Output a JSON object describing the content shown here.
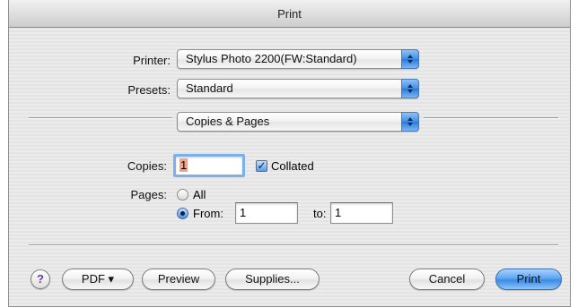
{
  "window": {
    "title": "Print"
  },
  "printer": {
    "label": "Printer:",
    "value": "Stylus Photo 2200(FW:Standard)"
  },
  "presets": {
    "label": "Presets:",
    "value": "Standard"
  },
  "panel": {
    "value": "Copies & Pages"
  },
  "copies": {
    "label": "Copies:",
    "value": "1",
    "collated_label": "Collated",
    "collated_checked": true,
    "check_glyph": "✓"
  },
  "pages": {
    "label": "Pages:",
    "all_label": "All",
    "from_label": "From:",
    "from_value": "1",
    "to_label": "to:",
    "to_value": "1",
    "selected": "From"
  },
  "buttons": {
    "help": "?",
    "pdf": "PDF ▾",
    "preview": "Preview",
    "supplies": "Supplies...",
    "cancel": "Cancel",
    "print": "Print"
  },
  "colors": {
    "accent": "#3b8be6",
    "selection": "#f1a38a",
    "focus_ring": "#7bb0ea"
  },
  "icons": {
    "help": "help-icon",
    "popup_arrows": "updown-arrows-icon",
    "checkbox": "checkmark-icon"
  }
}
